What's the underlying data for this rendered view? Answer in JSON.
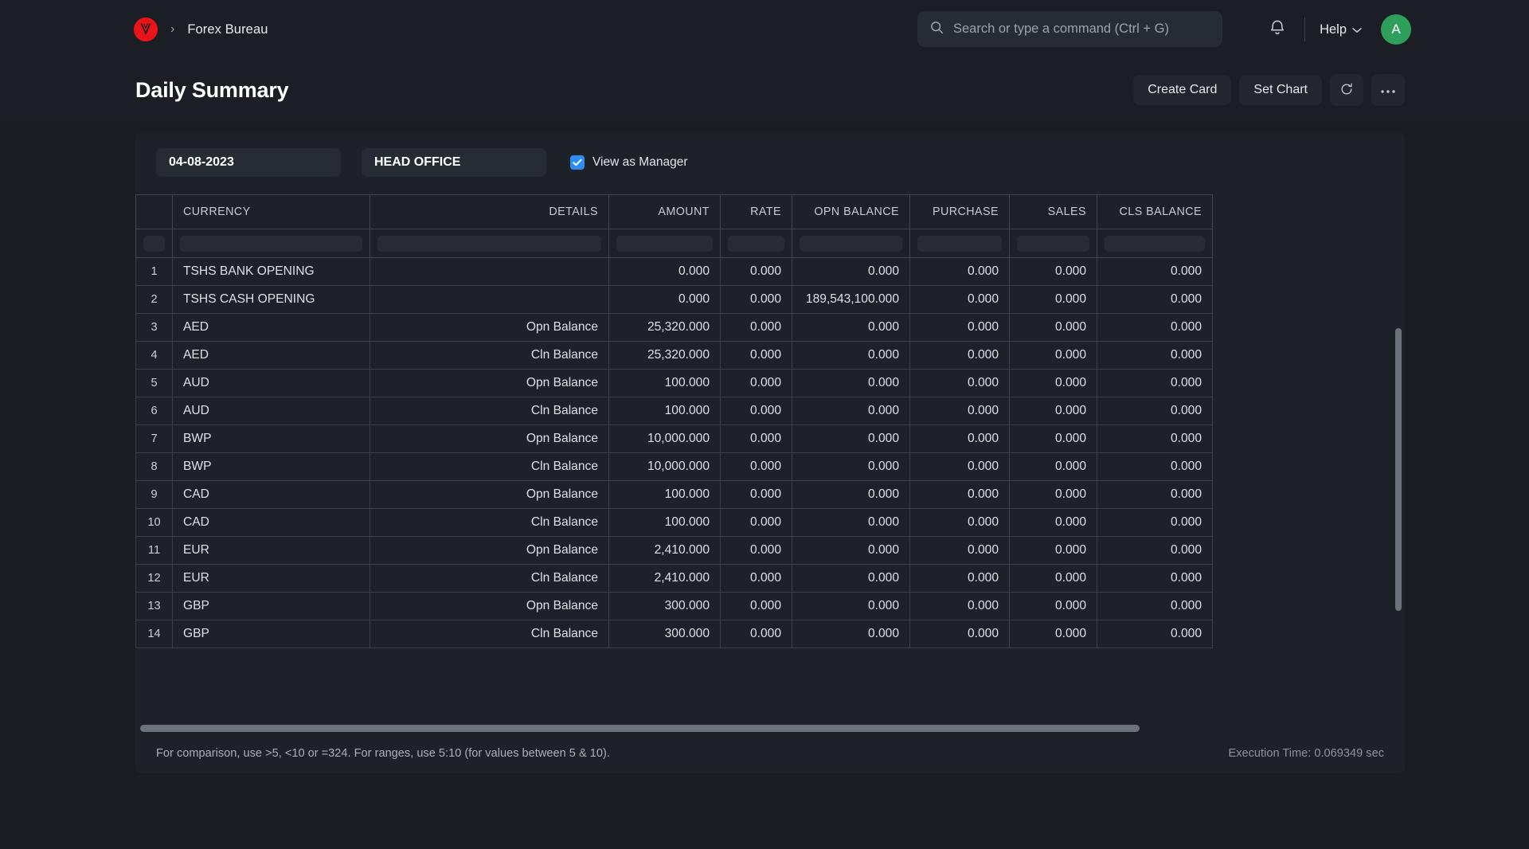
{
  "header": {
    "breadcrumb_separator": "›",
    "breadcrumb_text": "Forex Bureau",
    "logo_alt": "vellum-logo",
    "search_placeholder": "Search or type a command (Ctrl + G)",
    "help_label": "Help",
    "avatar_initial": "A",
    "accent_green": "#2e9e5b",
    "accent_red": "#e8141a",
    "accent_blue": "#2c8ef0"
  },
  "title_row": {
    "title": "Daily Summary",
    "create_card_label": "Create Card",
    "set_chart_label": "Set Chart",
    "refresh_label": "refresh",
    "more_label": "…"
  },
  "filters": {
    "date_value": "04-08-2023",
    "office_value": "HEAD OFFICE",
    "view_as_manager_label": "View as Manager",
    "view_as_manager_checked": true
  },
  "table": {
    "columns": [
      {
        "key": "idx",
        "label": "",
        "align": "left"
      },
      {
        "key": "currency",
        "label": "CURRENCY",
        "align": "left"
      },
      {
        "key": "details",
        "label": "DETAILS",
        "align": "right"
      },
      {
        "key": "amount",
        "label": "AMOUNT",
        "align": "right"
      },
      {
        "key": "rate",
        "label": "RATE",
        "align": "right"
      },
      {
        "key": "opn",
        "label": "OPN BALANCE",
        "align": "right"
      },
      {
        "key": "purchase",
        "label": "PURCHASE",
        "align": "right"
      },
      {
        "key": "sales",
        "label": "SALES",
        "align": "right"
      },
      {
        "key": "cls",
        "label": "CLS BALANCE",
        "align": "right"
      }
    ],
    "rows": [
      {
        "idx": "1",
        "currency": "TSHS BANK OPENING",
        "details": "",
        "amount": "0.000",
        "rate": "0.000",
        "opn": "0.000",
        "purchase": "0.000",
        "sales": "0.000",
        "cls": "0.000"
      },
      {
        "idx": "2",
        "currency": "TSHS CASH OPENING",
        "details": "",
        "amount": "0.000",
        "rate": "0.000",
        "opn": "189,543,100.000",
        "purchase": "0.000",
        "sales": "0.000",
        "cls": "0.000"
      },
      {
        "idx": "3",
        "currency": "AED",
        "details": "Opn Balance",
        "amount": "25,320.000",
        "rate": "0.000",
        "opn": "0.000",
        "purchase": "0.000",
        "sales": "0.000",
        "cls": "0.000"
      },
      {
        "idx": "4",
        "currency": "AED",
        "details": "Cln Balance",
        "amount": "25,320.000",
        "rate": "0.000",
        "opn": "0.000",
        "purchase": "0.000",
        "sales": "0.000",
        "cls": "0.000"
      },
      {
        "idx": "5",
        "currency": "AUD",
        "details": "Opn Balance",
        "amount": "100.000",
        "rate": "0.000",
        "opn": "0.000",
        "purchase": "0.000",
        "sales": "0.000",
        "cls": "0.000"
      },
      {
        "idx": "6",
        "currency": "AUD",
        "details": "Cln Balance",
        "amount": "100.000",
        "rate": "0.000",
        "opn": "0.000",
        "purchase": "0.000",
        "sales": "0.000",
        "cls": "0.000"
      },
      {
        "idx": "7",
        "currency": "BWP",
        "details": "Opn Balance",
        "amount": "10,000.000",
        "rate": "0.000",
        "opn": "0.000",
        "purchase": "0.000",
        "sales": "0.000",
        "cls": "0.000"
      },
      {
        "idx": "8",
        "currency": "BWP",
        "details": "Cln Balance",
        "amount": "10,000.000",
        "rate": "0.000",
        "opn": "0.000",
        "purchase": "0.000",
        "sales": "0.000",
        "cls": "0.000"
      },
      {
        "idx": "9",
        "currency": "CAD",
        "details": "Opn Balance",
        "amount": "100.000",
        "rate": "0.000",
        "opn": "0.000",
        "purchase": "0.000",
        "sales": "0.000",
        "cls": "0.000"
      },
      {
        "idx": "10",
        "currency": "CAD",
        "details": "Cln Balance",
        "amount": "100.000",
        "rate": "0.000",
        "opn": "0.000",
        "purchase": "0.000",
        "sales": "0.000",
        "cls": "0.000"
      },
      {
        "idx": "11",
        "currency": "EUR",
        "details": "Opn Balance",
        "amount": "2,410.000",
        "rate": "0.000",
        "opn": "0.000",
        "purchase": "0.000",
        "sales": "0.000",
        "cls": "0.000"
      },
      {
        "idx": "12",
        "currency": "EUR",
        "details": "Cln Balance",
        "amount": "2,410.000",
        "rate": "0.000",
        "opn": "0.000",
        "purchase": "0.000",
        "sales": "0.000",
        "cls": "0.000"
      },
      {
        "idx": "13",
        "currency": "GBP",
        "details": "Opn Balance",
        "amount": "300.000",
        "rate": "0.000",
        "opn": "0.000",
        "purchase": "0.000",
        "sales": "0.000",
        "cls": "0.000"
      },
      {
        "idx": "14",
        "currency": "GBP",
        "details": "Cln Balance",
        "amount": "300.000",
        "rate": "0.000",
        "opn": "0.000",
        "purchase": "0.000",
        "sales": "0.000",
        "cls": "0.000"
      }
    ]
  },
  "footer": {
    "hint": "For comparison, use >5, <10 or =324. For ranges, use 5:10 (for values between 5 & 10).",
    "execution_time": "Execution Time: 0.069349 sec"
  }
}
